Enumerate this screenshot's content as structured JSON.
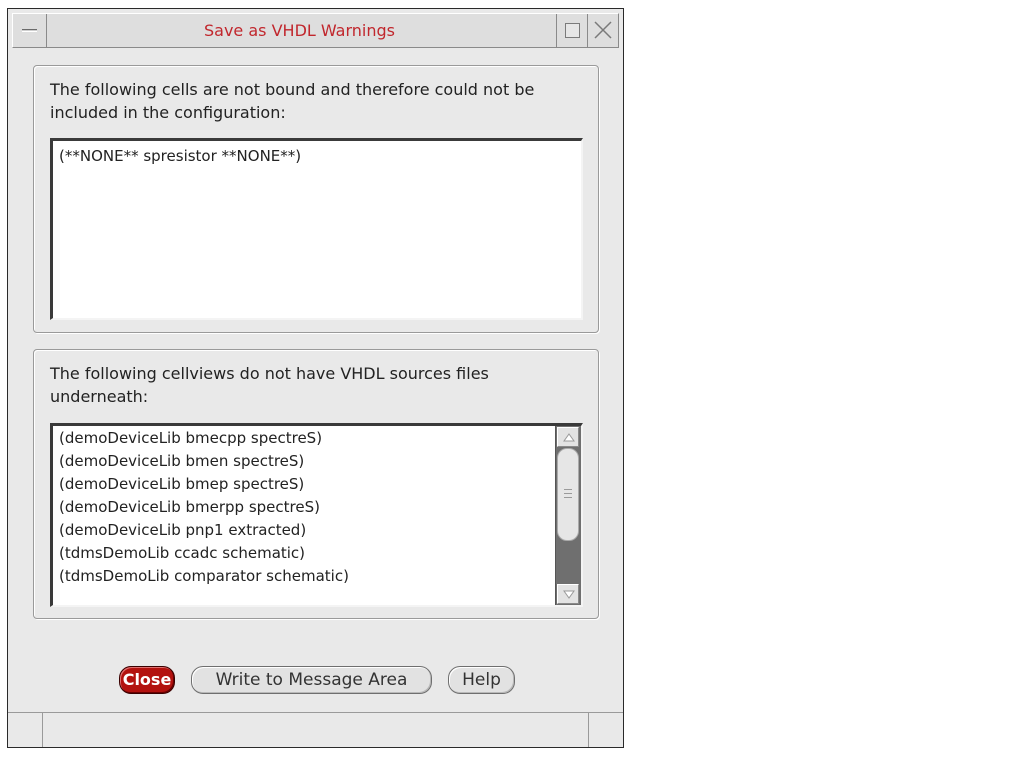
{
  "window": {
    "title": "Save as VHDL Warnings"
  },
  "unbound_section": {
    "label": "The following cells are not bound and therefore could not be included in the configuration:",
    "items": [
      "(**NONE** spresistor **NONE**)"
    ]
  },
  "cellviews_section": {
    "label": "The following cellviews do not have VHDL sources files underneath:",
    "items": [
      "(demoDeviceLib bmecpp spectreS)",
      "(demoDeviceLib bmen spectreS)",
      "(demoDeviceLib bmep spectreS)",
      "(demoDeviceLib bmerpp spectreS)",
      "(demoDeviceLib pnp1 extracted)",
      "(tdmsDemoLib ccadc schematic)",
      "(tdmsDemoLib comparator schematic)"
    ]
  },
  "buttons": {
    "close_label": "Close",
    "write_label": "Write to Message Area",
    "help_label": "Help"
  },
  "colors": {
    "title_text": "#c1272d",
    "close_button": "#b3120f"
  },
  "icons": {
    "window_menu": "window-menu-icon",
    "maximize": "maximize-icon",
    "close": "close-icon",
    "scroll_up": "scroll-up-arrow-icon",
    "scroll_down": "scroll-down-arrow-icon"
  }
}
